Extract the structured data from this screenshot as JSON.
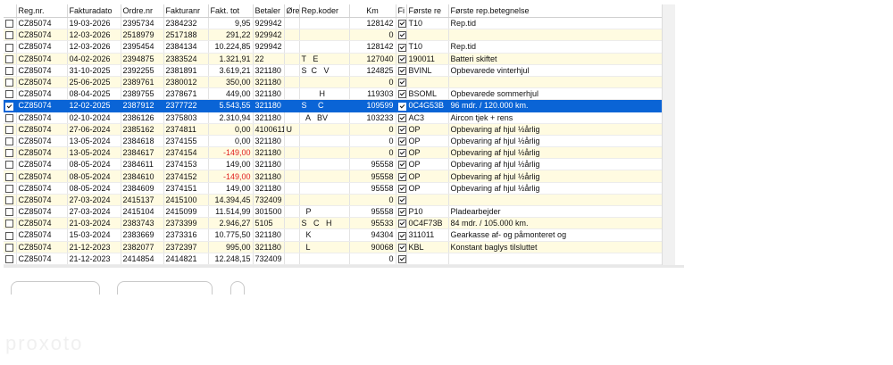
{
  "columns": [
    "Reg.nr.",
    "Fakturadato",
    "Ordre.nr",
    "Fakturanr",
    "Fakt. tot",
    "Betaler",
    "Øre",
    "Rep.koder",
    "Km",
    "Fi",
    "Første re",
    "Første rep.betegnelse"
  ],
  "rows": [
    {
      "check": false,
      "reg": "CZ85074",
      "date": "19-03-2026",
      "order": "2395734",
      "invoice": "2384232",
      "total": "9,95",
      "payer": "929942",
      "ore": "",
      "codes": "",
      "km": "128142",
      "fi": true,
      "first": "T10",
      "desc": "Rep.tid"
    },
    {
      "check": false,
      "reg": "CZ85074",
      "date": "12-03-2026",
      "order": "2518979",
      "invoice": "2517188",
      "total": "291,22",
      "payer": "929942",
      "ore": "",
      "codes": "",
      "km": "0",
      "fi": true,
      "first": "",
      "desc": ""
    },
    {
      "check": false,
      "reg": "CZ85074",
      "date": "12-03-2026",
      "order": "2395454",
      "invoice": "2384134",
      "total": "10.224,85",
      "payer": "929942",
      "ore": "",
      "codes": "",
      "km": "128142",
      "fi": true,
      "first": "T10",
      "desc": "Rep.tid"
    },
    {
      "check": false,
      "reg": "CZ85074",
      "date": "04-02-2026",
      "order": "2394875",
      "invoice": "2383524",
      "total": "1.321,91",
      "payer": "22",
      "ore": "",
      "codes": "T   E",
      "km": "127040",
      "fi": true,
      "first": "190011",
      "desc": "Batteri skiftet"
    },
    {
      "check": false,
      "reg": "CZ85074",
      "date": "31-10-2025",
      "order": "2392255",
      "invoice": "2381891",
      "total": "3.619,21",
      "payer": "321180",
      "ore": "",
      "codes": "S  C   V",
      "km": "124825",
      "fi": true,
      "first": "BVINL",
      "desc": "Opbevarede vinterhjul"
    },
    {
      "check": false,
      "reg": "CZ85074",
      "date": "25-06-2025",
      "order": "2389761",
      "invoice": "2380012",
      "total": "350,00",
      "payer": "321180",
      "ore": "",
      "codes": "",
      "km": "0",
      "fi": true,
      "first": "",
      "desc": ""
    },
    {
      "check": false,
      "reg": "CZ85074",
      "date": "08-04-2025",
      "order": "2389755",
      "invoice": "2378671",
      "total": "449,00",
      "payer": "321180",
      "ore": "",
      "codes": "        H",
      "km": "119303",
      "fi": true,
      "first": "BSOML",
      "desc": "Opbevarede sommerhjul"
    },
    {
      "check": true,
      "sel": true,
      "reg": "CZ85074",
      "date": "12-02-2025",
      "order": "2387912",
      "invoice": "2377722",
      "total": "5.543,55",
      "payer": "321180",
      "ore": "",
      "codes": "S     C",
      "km": "109599",
      "fi": true,
      "first": "0C4G53B",
      "desc": "96 mdr. / 120.000 km."
    },
    {
      "check": false,
      "reg": "CZ85074",
      "date": "02-10-2024",
      "order": "2386126",
      "invoice": "2375803",
      "total": "2.310,94",
      "payer": "321180",
      "ore": "",
      "codes": "  A   BV",
      "km": "103233",
      "fi": true,
      "first": "AC3",
      "desc": "Aircon tjek + rens"
    },
    {
      "check": false,
      "reg": "CZ85074",
      "date": "27-06-2024",
      "order": "2385162",
      "invoice": "2374811",
      "total": "0,00",
      "payer": "4100611",
      "ore": "U",
      "codes": "",
      "km": "0",
      "fi": true,
      "first": "OP",
      "desc": "Opbevaring af hjul ½årlig"
    },
    {
      "check": false,
      "reg": "CZ85074",
      "date": "13-05-2024",
      "order": "2384618",
      "invoice": "2374155",
      "total": "0,00",
      "payer": "321180",
      "ore": "",
      "codes": "",
      "km": "0",
      "fi": true,
      "first": "OP",
      "desc": "Opbevaring af hjul ½årlig"
    },
    {
      "check": false,
      "reg": "CZ85074",
      "date": "13-05-2024",
      "order": "2384617",
      "invoice": "2374154",
      "total": "-149,00",
      "neg": true,
      "payer": "321180",
      "ore": "",
      "codes": "",
      "km": "0",
      "fi": true,
      "first": "OP",
      "desc": "Opbevaring af hjul ½årlig"
    },
    {
      "check": false,
      "reg": "CZ85074",
      "date": "08-05-2024",
      "order": "2384611",
      "invoice": "2374153",
      "total": "149,00",
      "payer": "321180",
      "ore": "",
      "codes": "",
      "km": "95558",
      "fi": true,
      "first": "OP",
      "desc": "Opbevaring af hjul ½årlig"
    },
    {
      "check": false,
      "reg": "CZ85074",
      "date": "08-05-2024",
      "order": "2384610",
      "invoice": "2374152",
      "total": "-149,00",
      "neg": true,
      "payer": "321180",
      "ore": "",
      "codes": "",
      "km": "95558",
      "fi": true,
      "first": "OP",
      "desc": "Opbevaring af hjul ½årlig"
    },
    {
      "check": false,
      "reg": "CZ85074",
      "date": "08-05-2024",
      "order": "2384609",
      "invoice": "2374151",
      "total": "149,00",
      "payer": "321180",
      "ore": "",
      "codes": "",
      "km": "95558",
      "fi": true,
      "first": "OP",
      "desc": "Opbevaring af hjul ½årlig"
    },
    {
      "check": false,
      "reg": "CZ85074",
      "date": "27-03-2024",
      "order": "2415137",
      "invoice": "2415100",
      "total": "14.394,45",
      "payer": "732409",
      "ore": "",
      "codes": "",
      "km": "0",
      "fi": true,
      "first": "",
      "desc": ""
    },
    {
      "check": false,
      "reg": "CZ85074",
      "date": "27-03-2024",
      "order": "2415104",
      "invoice": "2415099",
      "total": "11.514,99",
      "payer": "301500",
      "ore": "",
      "codes": "  P",
      "km": "95558",
      "fi": true,
      "first": "P10",
      "desc": "Pladearbejder"
    },
    {
      "check": false,
      "reg": "CZ85074",
      "date": "21-03-2024",
      "order": "2383743",
      "invoice": "2373399",
      "total": "2.946,27",
      "payer": "5105",
      "ore": "",
      "codes": "S   C   H",
      "km": "95533",
      "fi": true,
      "first": "0C4F73B",
      "desc": "84 mdr. / 105.000 km."
    },
    {
      "check": false,
      "reg": "CZ85074",
      "date": "15-03-2024",
      "order": "2383669",
      "invoice": "2373316",
      "total": "10.775,50",
      "payer": "321180",
      "ore": "",
      "codes": "  K",
      "km": "94304",
      "fi": true,
      "first": "311011",
      "desc": "Gearkasse af- og påmonteret og"
    },
    {
      "check": false,
      "reg": "CZ85074",
      "date": "21-12-2023",
      "order": "2382077",
      "invoice": "2372397",
      "total": "995,00",
      "payer": "321180",
      "ore": "",
      "codes": "  L",
      "km": "90068",
      "fi": true,
      "first": "KBL",
      "desc": "Konstant baglys tilsluttet"
    },
    {
      "check": false,
      "reg": "CZ85074",
      "date": "21-12-2023",
      "order": "2414854",
      "invoice": "2414821",
      "total": "12.248,15",
      "payer": "732409",
      "ore": "",
      "codes": "",
      "km": "0",
      "fi": true,
      "first": "",
      "desc": ""
    }
  ],
  "watermark": "proxoto"
}
